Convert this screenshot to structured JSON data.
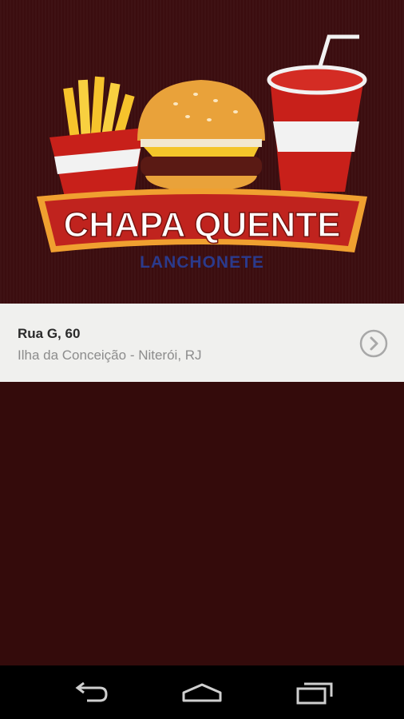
{
  "logo": {
    "title": "CHAPA QUENTE",
    "subtitle": "LANCHONETE"
  },
  "address": {
    "street": "Rua G, 60",
    "city": "Ilha da Conceição - Niterói, RJ"
  },
  "icons": {
    "chevron": "chevron-right-circle-icon",
    "back": "back-icon",
    "home": "home-icon",
    "recents": "recent-apps-icon"
  },
  "colors": {
    "background": "#340b0b",
    "card": "#f0f0ee",
    "banner_red": "#c0231e",
    "banner_gold": "#f0a030",
    "subtitle_blue": "#2b3a8c"
  }
}
